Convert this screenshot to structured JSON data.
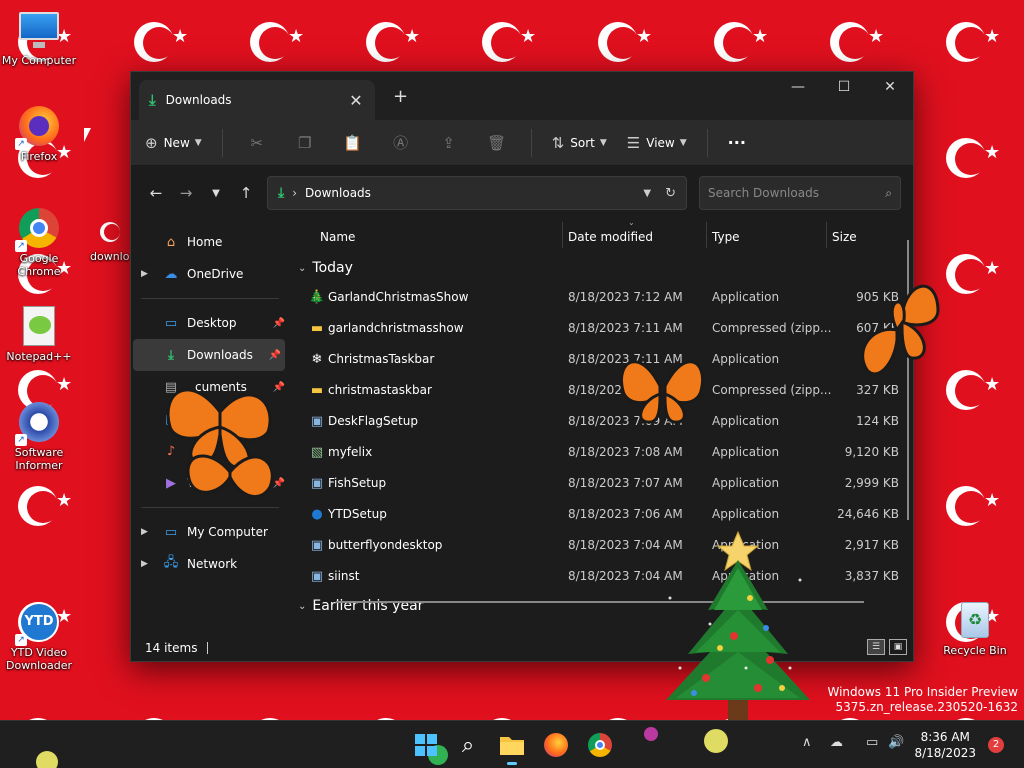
{
  "desktop": {
    "icons": [
      {
        "label": "My Computer"
      },
      {
        "label": "Firefox"
      },
      {
        "label": "Google Chrome"
      },
      {
        "label": "downlo"
      },
      {
        "label": "Notepad++"
      },
      {
        "label": "Software Informer"
      },
      {
        "label": "YTD Video Downloader"
      },
      {
        "label": "Recycle Bin"
      }
    ],
    "watermark": {
      "line1": "Windows 11 Pro Insider Preview",
      "line2": "5375.zn_release.230520-1632"
    }
  },
  "explorer": {
    "tab_title": "Downloads",
    "toolbar": {
      "new_label": "New",
      "sort_label": "Sort",
      "view_label": "View",
      "more_label": "···"
    },
    "address": {
      "crumb": "Downloads"
    },
    "search": {
      "placeholder": "Search Downloads"
    },
    "nav": {
      "home": "Home",
      "onedrive": "OneDrive",
      "desktop": "Desktop",
      "downloads": "Downloads",
      "documents": "cuments",
      "videos": "Vi",
      "my_computer": "My Computer",
      "network": "Network"
    },
    "columns": {
      "name": "Name",
      "date": "Date modified",
      "type": "Type",
      "size": "Size"
    },
    "groups": {
      "today": "Today",
      "earlier": "Earlier this year"
    },
    "files": [
      {
        "name": "GarlandChristmasShow",
        "date": "8/18/2023 7:12 AM",
        "type": "Application",
        "size": "905 KB",
        "icon": "garland-icon"
      },
      {
        "name": "garlandchristmasshow",
        "date": "8/18/2023 7:11 AM",
        "type": "Compressed (zipp...",
        "size": "607 KB",
        "icon": "zip-folder-icon"
      },
      {
        "name": "ChristmasTaskbar",
        "date": "8/18/2023 7:11 AM",
        "type": "Application",
        "size": "",
        "icon": "snowflake-icon"
      },
      {
        "name": "christmastaskbar",
        "date": "8/18/2023 7",
        "type": "Compressed (zipp...",
        "size": "327 KB",
        "icon": "zip-folder-icon"
      },
      {
        "name": "DeskFlagSetup",
        "date": "8/18/2023 7:09 AM",
        "type": "Application",
        "size": "124 KB",
        "icon": "setup-icon"
      },
      {
        "name": "myfelix",
        "date": "8/18/2023 7:08 AM",
        "type": "Application",
        "size": "9,120 KB",
        "icon": "image-app-icon"
      },
      {
        "name": "FishSetup",
        "date": "8/18/2023 7:07 AM",
        "type": "Application",
        "size": "2,999 KB",
        "icon": "setup-icon"
      },
      {
        "name": "YTDSetup",
        "date": "8/18/2023 7:06 AM",
        "type": "Application",
        "size": "24,646 KB",
        "icon": "ytd-icon"
      },
      {
        "name": "butterflyondesktop",
        "date": "8/18/2023 7:04 AM",
        "type": "Application",
        "size": "2,917 KB",
        "icon": "setup-icon"
      },
      {
        "name": "siinst",
        "date": "8/18/2023 7:04 AM",
        "type": "Application",
        "size": "3,837 KB",
        "icon": "setup-icon"
      }
    ],
    "status": {
      "count": "14 items"
    }
  },
  "taskbar": {
    "clock_time": "8:36 AM",
    "clock_date": "8/18/2023",
    "notification_count": "2"
  }
}
